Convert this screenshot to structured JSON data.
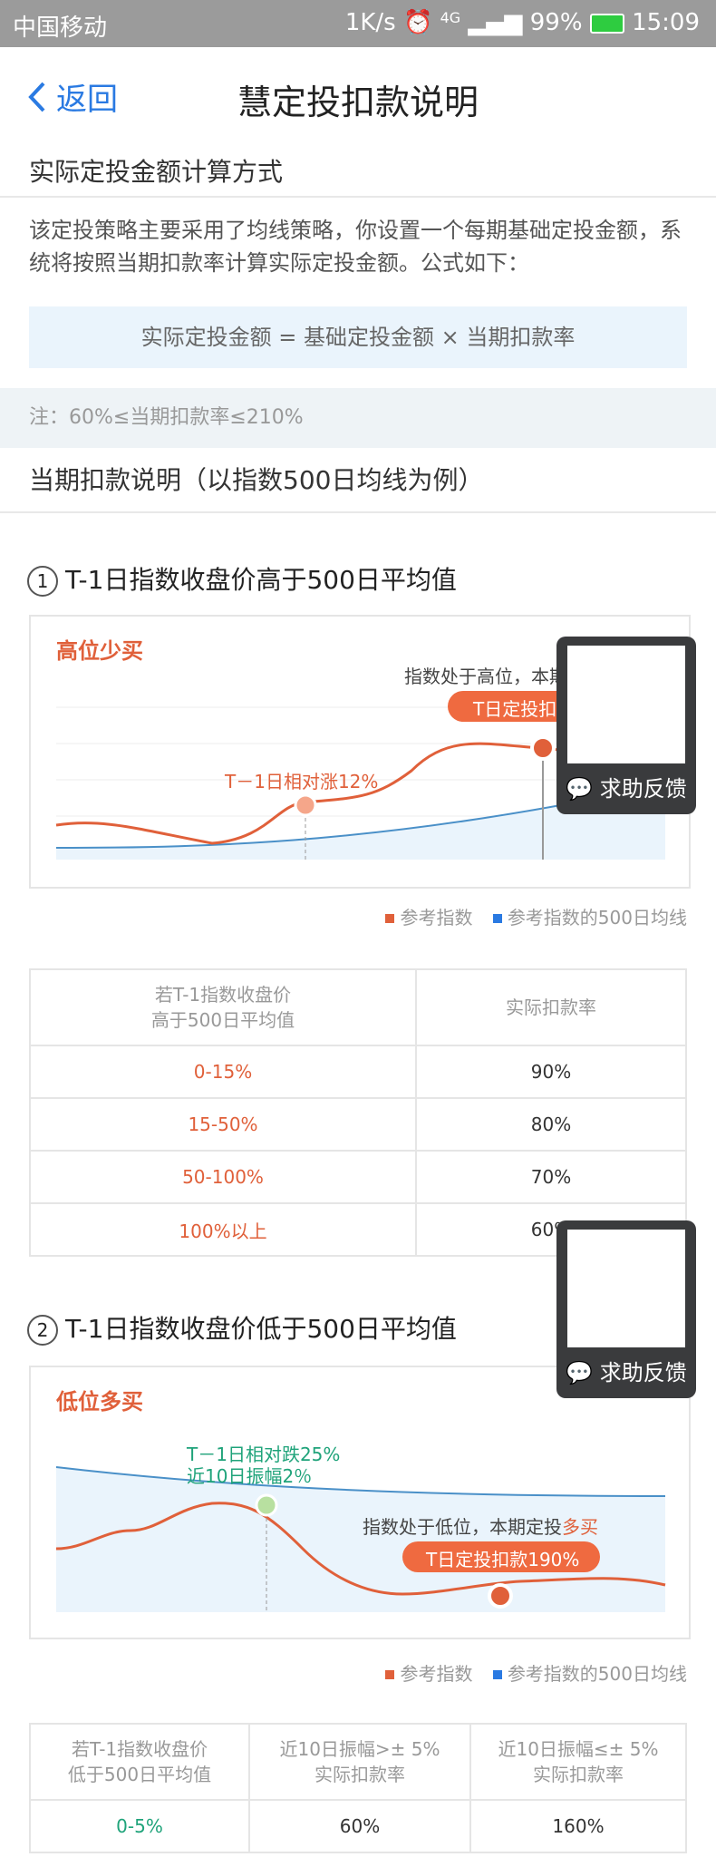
{
  "status": {
    "carrier": "中国移动",
    "speed": "1K/s",
    "net": "4G",
    "battery": "99%",
    "time": "15:09"
  },
  "nav": {
    "back_label": "返回",
    "title": "慧定投扣款说明"
  },
  "section1": {
    "title": "实际定投金额计算方式",
    "para": "该定投策略主要采用了均线策略，你设置一个每期基础定投金额，系统将按照当期扣款率计算实际定投金额。公式如下：",
    "formula": "实际定投金额 = 基础定投金额 × 当期扣款率",
    "note": "注：60%≤当期扣款率≤210%"
  },
  "section2": {
    "title": "当期扣款说明（以指数500日均线为例）"
  },
  "case1": {
    "num": "1",
    "title": "T-1日指数收盘价高于500日平均值",
    "chart": {
      "tag": "高位少买",
      "ann_rise": "T－1日相对涨12%",
      "headline": "指数处于高位，本期",
      "bubble": "T日定投扣款"
    },
    "legend": {
      "a": "参考指数",
      "b": "参考指数的500日均线"
    },
    "table": {
      "h1": "若T-1指数收盘价\n高于500日平均值",
      "h2": "实际扣款率",
      "rows": [
        [
          "0-15%",
          "90%"
        ],
        [
          "15-50%",
          "80%"
        ],
        [
          "50-100%",
          "70%"
        ],
        [
          "100%以上",
          "60%"
        ]
      ]
    }
  },
  "case2": {
    "num": "2",
    "title": "T-1日指数收盘价低于500日平均值",
    "chart": {
      "tag": "低位多买",
      "ann1": "T－1日相对跌25%",
      "ann2": "近10日振幅2％",
      "headline_a": "指数处于低位，本期定投",
      "headline_b": "多买",
      "bubble": "T日定投扣款190%"
    },
    "legend": {
      "a": "参考指数",
      "b": "参考指数的500日均线"
    },
    "table": {
      "h1": "若T-1指数收盘价\n低于500日平均值",
      "h2": "近10日振幅>± 5%\n实际扣款率",
      "h3": "近10日振幅≤± 5%\n实际扣款率",
      "rows": [
        [
          "0-5%",
          "60%",
          "160%"
        ]
      ]
    }
  },
  "feedback": {
    "label": "求助反馈"
  },
  "colors": {
    "accent": "#2a7ae2",
    "orange": "#e0603a",
    "green": "#1fa37a"
  }
}
